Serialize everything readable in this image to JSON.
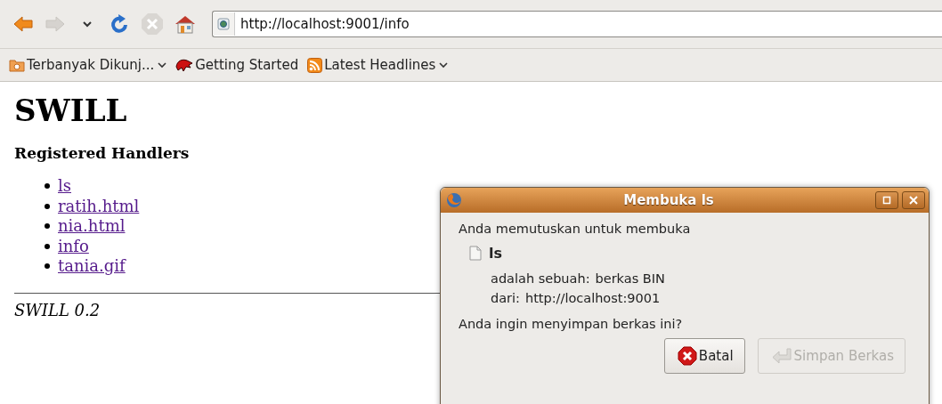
{
  "toolbar": {
    "nav": [
      {
        "kind": "back",
        "disabled": false
      },
      {
        "kind": "forward",
        "disabled": true
      },
      {
        "kind": "history",
        "disabled": false
      },
      {
        "kind": "reload",
        "disabled": false
      },
      {
        "kind": "stop",
        "disabled": true
      },
      {
        "kind": "home",
        "disabled": false
      }
    ],
    "address": "http://localhost:9001/info"
  },
  "bookmarks": [
    {
      "kind": "folder",
      "label": "Terbanyak Dikunj...",
      "dropdown": true
    },
    {
      "kind": "page",
      "label": "Getting Started",
      "dropdown": false
    },
    {
      "kind": "feed",
      "label": "Latest Headlines",
      "dropdown": true
    }
  ],
  "page": {
    "title": "SWILL",
    "subtitle": "Registered Handlers",
    "links": [
      "ls",
      "ratih.html",
      "nia.html",
      "info",
      "tania.gif"
    ],
    "footer": "SWILL 0.2"
  },
  "dialog": {
    "title": "Membuka ls",
    "intro": "Anda memutuskan untuk membuka",
    "file": "ls",
    "type_label": "adalah sebuah:",
    "type_value": "berkas BIN",
    "from_label": "dari:",
    "from_value": "http://localhost:9001",
    "question": "Anda ingin menyimpan berkas ini?",
    "buttons": [
      {
        "kind": "cancel",
        "label": "Batal",
        "disabled": false
      },
      {
        "kind": "save",
        "label": "Simpan Berkas",
        "disabled": true
      }
    ]
  }
}
